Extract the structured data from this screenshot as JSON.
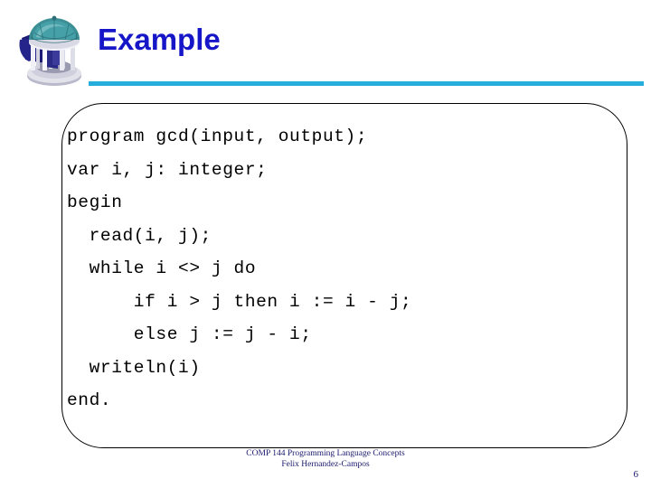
{
  "slide": {
    "title": "Example",
    "page_number": "6",
    "accent_rule_color": "#25aedb",
    "title_color": "#1616c8",
    "footer_color": "#1a1a6e"
  },
  "logo": {
    "name": "unc-old-well-logo",
    "dome_color": "#3d8f96",
    "dome_highlight": "#7fc3c8",
    "shadow_color": "#1c1c78",
    "column_color": "#dcdce4",
    "base_color": "#c9c9d6"
  },
  "code": {
    "language": "pascal",
    "lines": [
      "program gcd(input, output);",
      "var i, j: integer;",
      "begin",
      "  read(i, j);",
      "  while i <> j do",
      "      if i > j then i := i - j;",
      "      else j := j - i;",
      "  writeln(i)",
      "end."
    ]
  },
  "footer": {
    "course": "COMP 144 Programming Language Concepts",
    "author": "Felix Hernandez-Campos"
  }
}
